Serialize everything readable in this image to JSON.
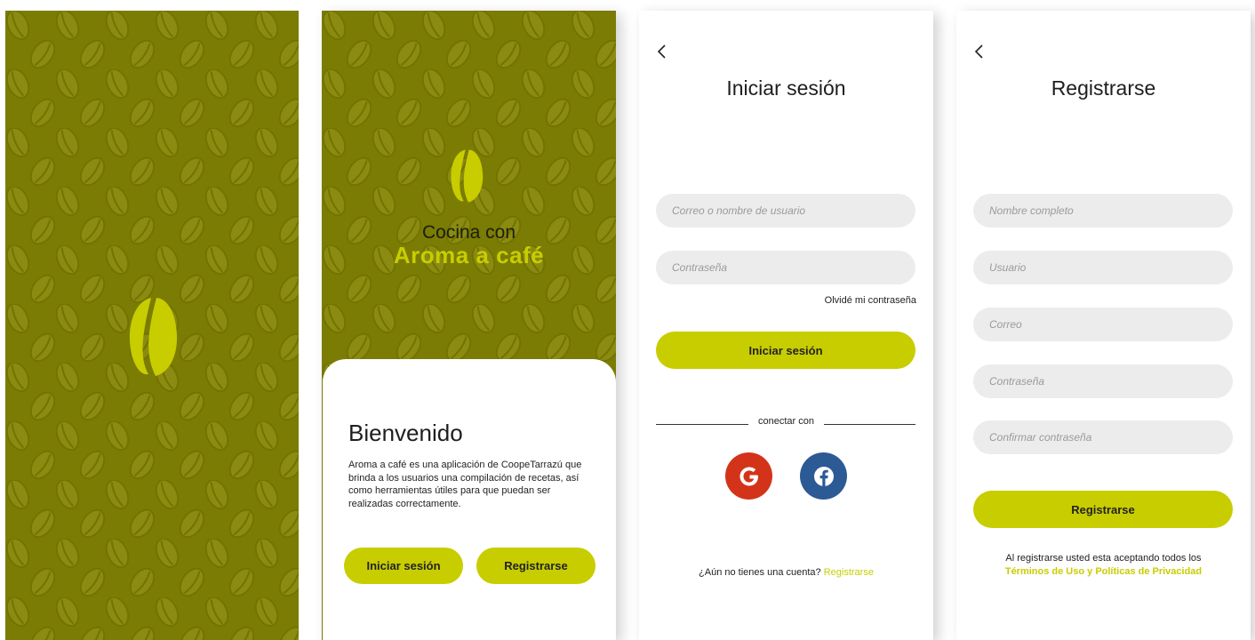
{
  "colors": {
    "olive": "#7b7c03",
    "lime": "#c8cd00",
    "field": "#ececec",
    "google": "#d33419",
    "facebook": "#2c5a95"
  },
  "splash": {
    "logo_icon": "coffee-bean-icon"
  },
  "welcome": {
    "brand_line1": "Cocina con",
    "brand_line2": "Aroma a café",
    "heading": "Bienvenido",
    "description": "Aroma a café es una aplicación de CoopeTarrazú que brinda a los usuarios una compilación de recetas, así como herramientas útiles para que puedan ser realizadas correctamente.",
    "login_button": "Iniciar sesión",
    "register_button": "Registrarse"
  },
  "login": {
    "back_icon": "chevron-left-icon",
    "title": "Iniciar sesión",
    "username_placeholder": "Correo o nombre de usuario",
    "password_placeholder": "Contraseña",
    "forgot_link": "Olvidé mi contraseña",
    "submit_button": "Iniciar sesión",
    "connect_with": "conectar con",
    "google_icon": "google-icon",
    "facebook_icon": "facebook-icon",
    "no_account_text": "¿Aún no tienes una cuenta?",
    "register_link": "Registrarse"
  },
  "register": {
    "back_icon": "chevron-left-icon",
    "title": "Registrarse",
    "fullname_placeholder": "Nombre completo",
    "user_placeholder": "Usuario",
    "email_placeholder": "Correo",
    "password_placeholder": "Contraseña",
    "confirm_placeholder": "Confirmar contraseña",
    "submit_button": "Registrarse",
    "terms_text": "Al registrarse usted esta aceptando todos los",
    "terms_link": "Términos de Uso y Políticas de Privacidad"
  }
}
